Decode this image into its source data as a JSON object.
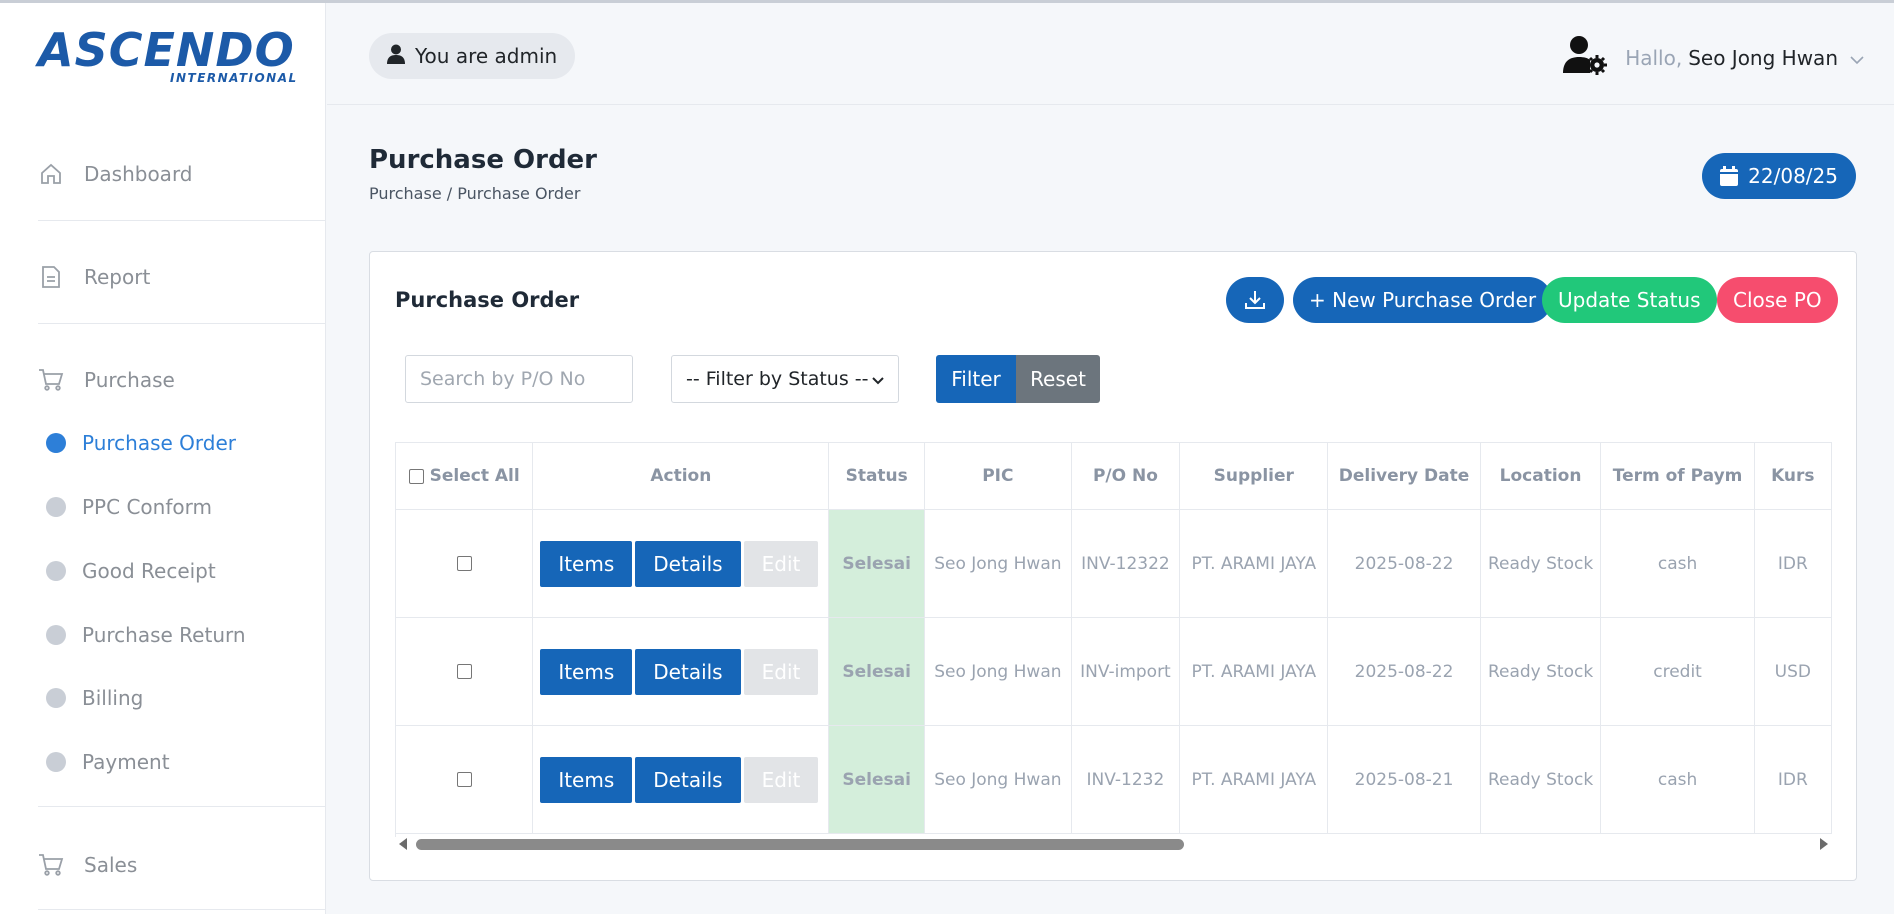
{
  "brand": {
    "name": "ASCENDO",
    "sub": "INTERNATIONAL"
  },
  "sidebar": {
    "items": [
      {
        "label": "Dashboard",
        "icon": "home-icon"
      },
      {
        "label": "Report",
        "icon": "document-icon"
      },
      {
        "label": "Purchase",
        "icon": "cart-icon"
      }
    ],
    "purchase_sub": [
      {
        "label": "Purchase Order",
        "active": true
      },
      {
        "label": "PPC Conform"
      },
      {
        "label": "Good Receipt"
      },
      {
        "label": "Purchase Return"
      },
      {
        "label": "Billing"
      },
      {
        "label": "Payment"
      }
    ],
    "sales": {
      "label": "Sales",
      "icon": "cart-icon"
    }
  },
  "header": {
    "role_label": "You are admin",
    "greeting": "Hallo,",
    "user_name": "Seo Jong Hwan"
  },
  "page": {
    "title": "Purchase Order",
    "breadcrumb": "Purchase / Purchase Order",
    "date": "22/08/25"
  },
  "card": {
    "title": "Purchase Order",
    "new_label": "+ New Purchase Order",
    "update_label": "Update Status",
    "close_label": "Close PO",
    "search_placeholder": "Search by P/O No",
    "status_filter": "-- Filter by Status --",
    "filter_label": "Filter",
    "reset_label": "Reset"
  },
  "table": {
    "select_all": "Select All",
    "columns": [
      "Action",
      "Status",
      "PIC",
      "P/O No",
      "Supplier",
      "Delivery Date",
      "Location",
      "Term of Paym",
      "Kurs"
    ],
    "action_labels": {
      "items": "Items",
      "details": "Details",
      "edit": "Edit"
    },
    "rows": [
      {
        "status": "Selesai",
        "pic": "Seo Jong Hwan",
        "po_no": "INV-12322",
        "supplier": "PT. ARAMI JAYA",
        "delivery_date": "2025-08-22",
        "location": "Ready Stock",
        "term": "cash",
        "kurs": "IDR"
      },
      {
        "status": "Selesai",
        "pic": "Seo Jong Hwan",
        "po_no": "INV-import",
        "supplier": "PT. ARAMI JAYA",
        "delivery_date": "2025-08-22",
        "location": "Ready Stock",
        "term": "credit",
        "kurs": "USD"
      },
      {
        "status": "Selesai",
        "pic": "Seo Jong Hwan",
        "po_no": "INV-1232",
        "supplier": "PT. ARAMI JAYA",
        "delivery_date": "2025-08-21",
        "location": "Ready Stock",
        "term": "cash",
        "kurs": "IDR"
      }
    ]
  },
  "colors": {
    "primary": "#1666b8",
    "success": "#21c87a",
    "danger": "#f64d6e",
    "secondary": "#6c757d",
    "status_done_bg": "#d4eedb"
  }
}
